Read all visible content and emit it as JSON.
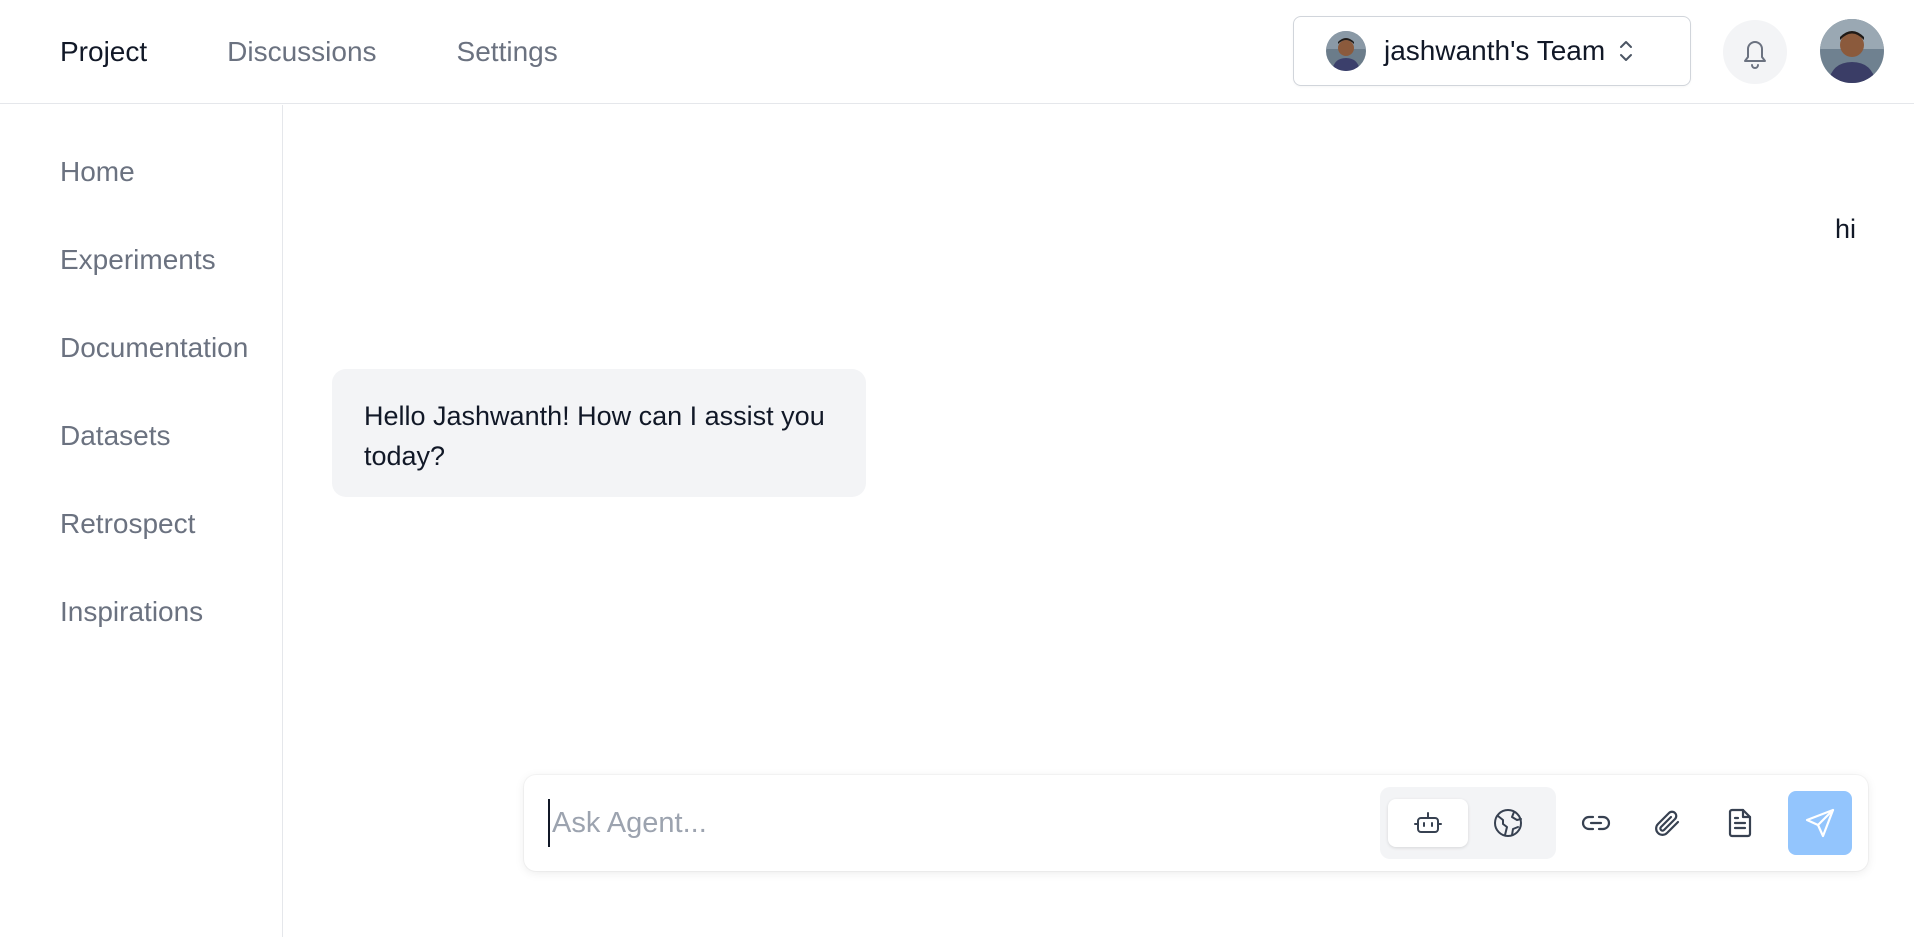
{
  "header": {
    "nav": [
      {
        "label": "Project",
        "active": true
      },
      {
        "label": "Discussions",
        "active": false
      },
      {
        "label": "Settings",
        "active": false
      }
    ],
    "team_switcher": {
      "name": "jashwanth's Team",
      "icon": "chevron-up-down-icon"
    },
    "notifications_icon": "bell-icon",
    "user_avatar_icon": "avatar"
  },
  "sidebar": {
    "items": [
      {
        "label": "Home"
      },
      {
        "label": "Experiments"
      },
      {
        "label": "Documentation"
      },
      {
        "label": "Datasets"
      },
      {
        "label": "Retrospect"
      },
      {
        "label": "Inspirations"
      }
    ]
  },
  "chat": {
    "messages": [
      {
        "role": "user",
        "text": "hi"
      },
      {
        "role": "agent",
        "text": "Hello Jashwanth! How can I assist you today?"
      }
    ]
  },
  "composer": {
    "placeholder": "Ask Agent...",
    "value": "",
    "modes": [
      {
        "icon": "robot-icon",
        "active": true
      },
      {
        "icon": "globe-icon",
        "active": false
      }
    ],
    "tools": [
      "link-icon",
      "paperclip-icon",
      "document-icon"
    ],
    "send_icon": "send-icon",
    "colors": {
      "send_button": "#93c5fd"
    }
  }
}
